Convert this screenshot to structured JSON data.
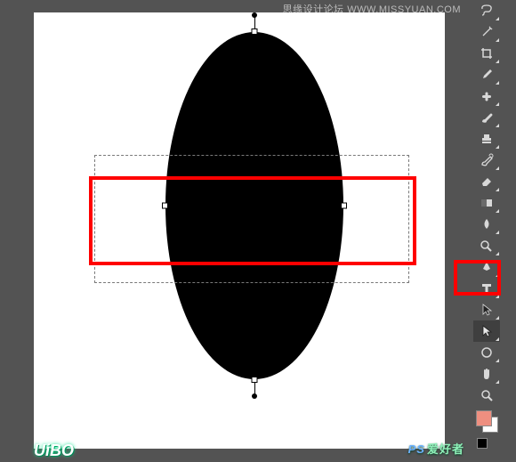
{
  "watermarks": {
    "top": "思缘设计论坛  WWW.MISSYUAN.COM",
    "bottom_left": "UiBO",
    "bottom_right_prefix": "PS",
    "bottom_right": "爱好者"
  },
  "colors": {
    "highlight": "#ff0000",
    "canvas_bg": "#ffffff",
    "workspace_bg": "#535353",
    "shape_fill": "#000000",
    "swatch_foreground": "#ee8f80"
  },
  "tools": [
    {
      "name": "lasso",
      "selected": false
    },
    {
      "name": "magic-wand",
      "selected": false
    },
    {
      "name": "crop",
      "selected": false
    },
    {
      "name": "eyedropper",
      "selected": false
    },
    {
      "name": "healing-brush",
      "selected": false
    },
    {
      "name": "brush",
      "selected": false
    },
    {
      "name": "clone-stamp",
      "selected": false
    },
    {
      "name": "history-brush",
      "selected": false
    },
    {
      "name": "eraser",
      "selected": false
    },
    {
      "name": "gradient",
      "selected": false
    },
    {
      "name": "blur",
      "selected": false
    },
    {
      "name": "dodge",
      "selected": false
    },
    {
      "name": "pen",
      "selected": false
    },
    {
      "name": "type",
      "selected": false
    },
    {
      "name": "path-selection",
      "selected": false
    },
    {
      "name": "direct-selection",
      "selected": true
    },
    {
      "name": "shape",
      "selected": false
    },
    {
      "name": "hand",
      "selected": false
    },
    {
      "name": "zoom",
      "selected": false
    }
  ]
}
